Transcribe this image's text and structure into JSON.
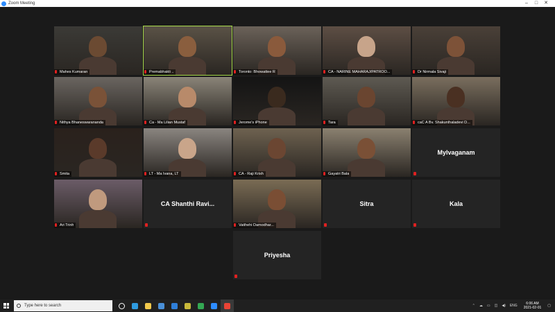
{
  "window": {
    "title": "Zoom Meeting",
    "minimize": "–",
    "maximize": "□",
    "close": "✕"
  },
  "participants": [
    {
      "name": "Mahes Kumaran",
      "has_video": true,
      "bg": "#3b3a36",
      "skin": "#6b4a32"
    },
    {
      "name": "Premabhakti ..",
      "has_video": true,
      "bg": "#5a5246",
      "skin": "#8a5e3e",
      "active": true
    },
    {
      "name": "Toronto: Bhowattee R",
      "has_video": true,
      "bg": "#6b6259",
      "skin": "#8a5a3c"
    },
    {
      "name": "CA - NARINE MAHARAJ/PATROO...",
      "has_video": true,
      "bg": "#5d4e44",
      "skin": "#c7a48a"
    },
    {
      "name": "Dr Nirmala Sivaji",
      "has_video": true,
      "bg": "#4a4038",
      "skin": "#7d5238"
    },
    {
      "name": "Nithya Bhaneswarananda",
      "has_video": true,
      "bg": "#6a6560",
      "skin": "#7a5238"
    },
    {
      "name": "Ca - Ma Lilian Mustaf",
      "has_video": true,
      "bg": "#8a8478",
      "skin": "#b88a6a"
    },
    {
      "name": "Jerome's iPhone",
      "has_video": true,
      "bg": "#141414",
      "skin": "#3a2a1e"
    },
    {
      "name": "Tara",
      "has_video": true,
      "bg": "#5e5a52",
      "skin": "#6a4530"
    },
    {
      "name": "caC A Bv. Shakunthaladevi D...",
      "has_video": true,
      "bg": "#7a6e5e",
      "skin": "#4a3022"
    },
    {
      "name": "Smita",
      "has_video": true,
      "bg": "#2a211c",
      "skin": "#5a3a2a"
    },
    {
      "name": "LT - Ma Ivana, LT",
      "has_video": true,
      "bg": "#8a8580",
      "skin": "#c9a58a"
    },
    {
      "name": "CA - Raji Krish",
      "has_video": true,
      "bg": "#6e6250",
      "skin": "#6b4632"
    },
    {
      "name": "Gayatri Bala",
      "has_video": true,
      "bg": "#8b8170",
      "skin": "#7a5036"
    },
    {
      "name": "Mylvaganam",
      "has_video": false
    },
    {
      "name": "Ari Trinh",
      "has_video": true,
      "bg": "#6b5c68",
      "skin": "#c09a7e"
    },
    {
      "name": "CA Shanthi Ravi...",
      "has_video": false
    },
    {
      "name": "Vaithehi Damodhar...",
      "has_video": true,
      "bg": "#7a6c54",
      "skin": "#7a4e34"
    },
    {
      "name": "Sitra",
      "has_video": false
    },
    {
      "name": "Kala",
      "has_video": false
    },
    {
      "name": "Priyesha",
      "has_video": false
    }
  ],
  "taskbar": {
    "search_placeholder": "Type here to search",
    "apps": [
      {
        "icon": "task-view-icon",
        "color": "#ffffff"
      },
      {
        "icon": "edge-icon",
        "color": "#2f9be0"
      },
      {
        "icon": "file-explorer-icon",
        "color": "#f2c94c"
      },
      {
        "icon": "store-icon",
        "color": "#4a90d9"
      },
      {
        "icon": "mail-icon",
        "color": "#2f7fd9"
      },
      {
        "icon": "sticky-notes-icon",
        "color": "#c9b93a"
      },
      {
        "icon": "chrome-icon",
        "color": "#34a853"
      },
      {
        "icon": "zoom-icon",
        "color": "#2d8cff"
      },
      {
        "icon": "chrome-alt-icon",
        "color": "#ea4335"
      }
    ],
    "language": "ENG",
    "time": "6:06 AM",
    "date": "2021-02-01"
  }
}
